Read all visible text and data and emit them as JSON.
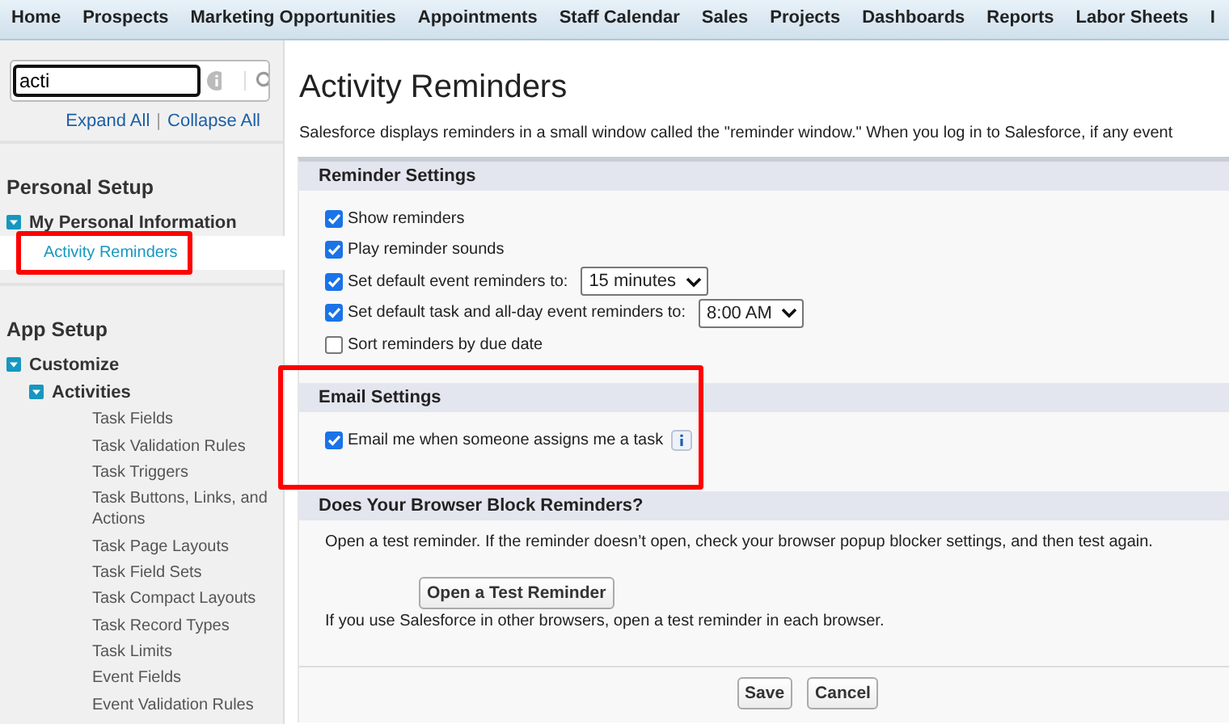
{
  "nav": {
    "tabs": [
      {
        "label": "Home"
      },
      {
        "label": "Prospects"
      },
      {
        "label": "Marketing Opportunities"
      },
      {
        "label": "Appointments"
      },
      {
        "label": "Staff Calendar"
      },
      {
        "label": "Sales"
      },
      {
        "label": "Projects"
      },
      {
        "label": "Dashboards"
      },
      {
        "label": "Reports"
      },
      {
        "label": "Labor Sheets"
      },
      {
        "label": "I"
      }
    ]
  },
  "sidebar": {
    "search": {
      "value": "acti"
    },
    "links": [
      "Expand All",
      "Collapse All"
    ],
    "link_separator": "|",
    "sections": [
      {
        "title": "Personal Setup",
        "tree": [
          {
            "label": "My Personal Information",
            "expanded": true,
            "children": [
              {
                "label": "Activity Reminders",
                "selected": true,
                "highlighted": true
              }
            ]
          }
        ]
      },
      {
        "title": "App Setup",
        "tree": [
          {
            "label": "Customize",
            "expanded": true,
            "children": [
              {
                "label": "Activities",
                "expanded": true,
                "children": [
                  {
                    "label": "Task Fields",
                    "selected": false
                  },
                  {
                    "label": "Task Validation Rules",
                    "selected": false
                  },
                  {
                    "label": "Task Triggers",
                    "selected": false
                  },
                  {
                    "label": "Task Buttons, Links, and Actions",
                    "selected": false
                  },
                  {
                    "label": "Task Page Layouts",
                    "selected": false
                  },
                  {
                    "label": "Task Field Sets",
                    "selected": false
                  },
                  {
                    "label": "Task Compact Layouts",
                    "selected": false
                  },
                  {
                    "label": "Task Record Types",
                    "selected": false
                  },
                  {
                    "label": "Task Limits",
                    "selected": false
                  },
                  {
                    "label": "Event Fields",
                    "selected": false
                  },
                  {
                    "label": "Event Validation Rules",
                    "selected": false
                  }
                ]
              }
            ]
          }
        ]
      }
    ]
  },
  "main": {
    "title": "Activity Reminders",
    "intro": "Salesforce displays reminders in a small window called the \"reminder window.\" When you log in to Salesforce, if any event",
    "sections": [
      {
        "title": "Reminder Settings",
        "kind": "settings",
        "highlighted": false,
        "rows": [
          {
            "label": "Show reminders",
            "checked": true
          },
          {
            "label": "Play reminder sounds",
            "checked": true
          },
          {
            "label": "Set default event reminders to:",
            "checked": true,
            "select": "15 minutes"
          },
          {
            "label": "Set default task and all-day event reminders to:",
            "checked": true,
            "select": "8:00 AM"
          },
          {
            "label": "Sort reminders by due date",
            "checked": false
          }
        ]
      },
      {
        "title": "Email Settings",
        "kind": "settings",
        "highlighted": true,
        "rows": [
          {
            "label": "Email me when someone assigns me a task",
            "checked": true,
            "info": true
          }
        ]
      },
      {
        "title": "Does Your Browser Block Reminders?",
        "kind": "text",
        "highlighted": false,
        "text": "Open a test reminder. If the reminder doesn’t open, check your browser popup blocker settings, and then test again.",
        "button": "Open a Test Reminder",
        "note": "If you use Salesforce in other browsers, open a test reminder in each browser."
      }
    ],
    "footer_buttons": [
      "Save",
      "Cancel"
    ]
  }
}
